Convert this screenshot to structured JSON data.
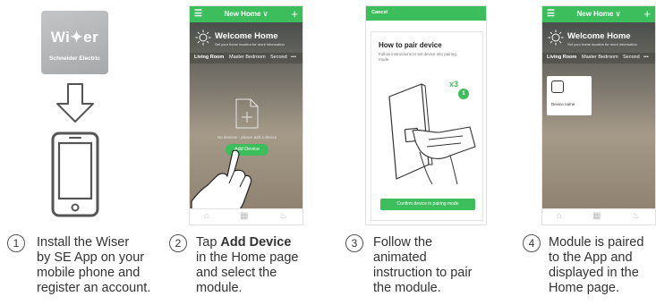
{
  "step1": {
    "number": "1",
    "text": [
      "Install the Wiser",
      "by SE App on your",
      "mobile phone and",
      "register an account."
    ],
    "app_icon": {
      "brand": "Wi✦er",
      "maker": "Schneider Electric",
      "color": "#b0b2b4"
    },
    "arrow_icon": "down-arrow-icon",
    "phone_icon": "smartphone-icon"
  },
  "step2": {
    "number": "2",
    "text_prefix": "Tap ",
    "text_bold": "Add Device",
    "text_rest": [
      "in the Home page",
      "and select the",
      "module."
    ],
    "screen": {
      "header_title": "New Home ∨",
      "welcome_title": "Welcome Home",
      "welcome_sub": "Set your home location for more information",
      "rooms": [
        "Living Room",
        "Master Bedroom",
        "Second",
        "•••"
      ],
      "empty_text": "No devices - please add a device",
      "add_button": "Add Device"
    }
  },
  "step3": {
    "number": "3",
    "text": [
      "Follow the",
      "animated",
      "instruction to pair",
      "the module."
    ],
    "screen": {
      "cancel": "Cancel",
      "title": "How to pair device",
      "subtitle": "Follow instructions to set device into pairing mode.",
      "repeat": "x3",
      "marker": "1",
      "confirm_button": "Confirm device in pairing mode"
    }
  },
  "step4": {
    "number": "4",
    "text": [
      "Module is paired",
      "to the App and",
      "displayed in the",
      "Home page."
    ],
    "screen": {
      "header_title": "New Home ∨",
      "welcome_title": "Welcome Home",
      "welcome_sub": "Set your home location for more information",
      "rooms": [
        "Living Room",
        "Master Bedroom",
        "Second",
        "•••"
      ],
      "device_name": "Device name"
    }
  },
  "colors": {
    "accent": "#3dbe5c",
    "text": "#333333"
  }
}
